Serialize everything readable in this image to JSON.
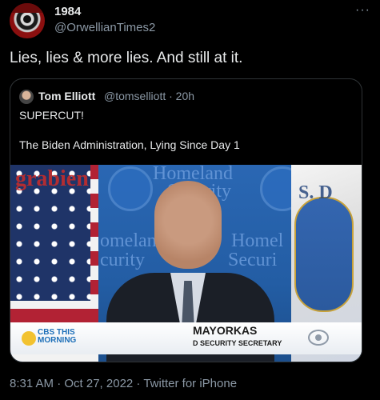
{
  "author": {
    "name": "1984",
    "handle": "@OrwellianTimes2"
  },
  "more_label": "···",
  "tweet_text": "Lies, lies & more lies. And still at it.",
  "quoted_tweet": {
    "name": "Tom Elliott",
    "handle_time": "@tomselliott · 20h",
    "line1": "SUPERCUT!",
    "line2": "The Biden Administration, Lying Since Day 1"
  },
  "media": {
    "watermark": "grabien",
    "bg_text_1": "Homeland",
    "bg_text_2": "Security",
    "bg_text_3": "omeland",
    "bg_text_4": "curity",
    "bg_text_5": "Homel",
    "bg_text_6": "Securi",
    "bg_text_7": "S. D",
    "network_text": "CBS THIS MORNING",
    "lower_third_name": "MAYORKAS",
    "lower_third_title": "D SECURITY SECRETARY"
  },
  "timestamp": "8:31 AM · Oct 27, 2022 · Twitter for iPhone",
  "colors": {
    "background": "#000000",
    "text": "#e7e9ea",
    "secondary": "#8b98a5",
    "border": "#2f3336"
  }
}
